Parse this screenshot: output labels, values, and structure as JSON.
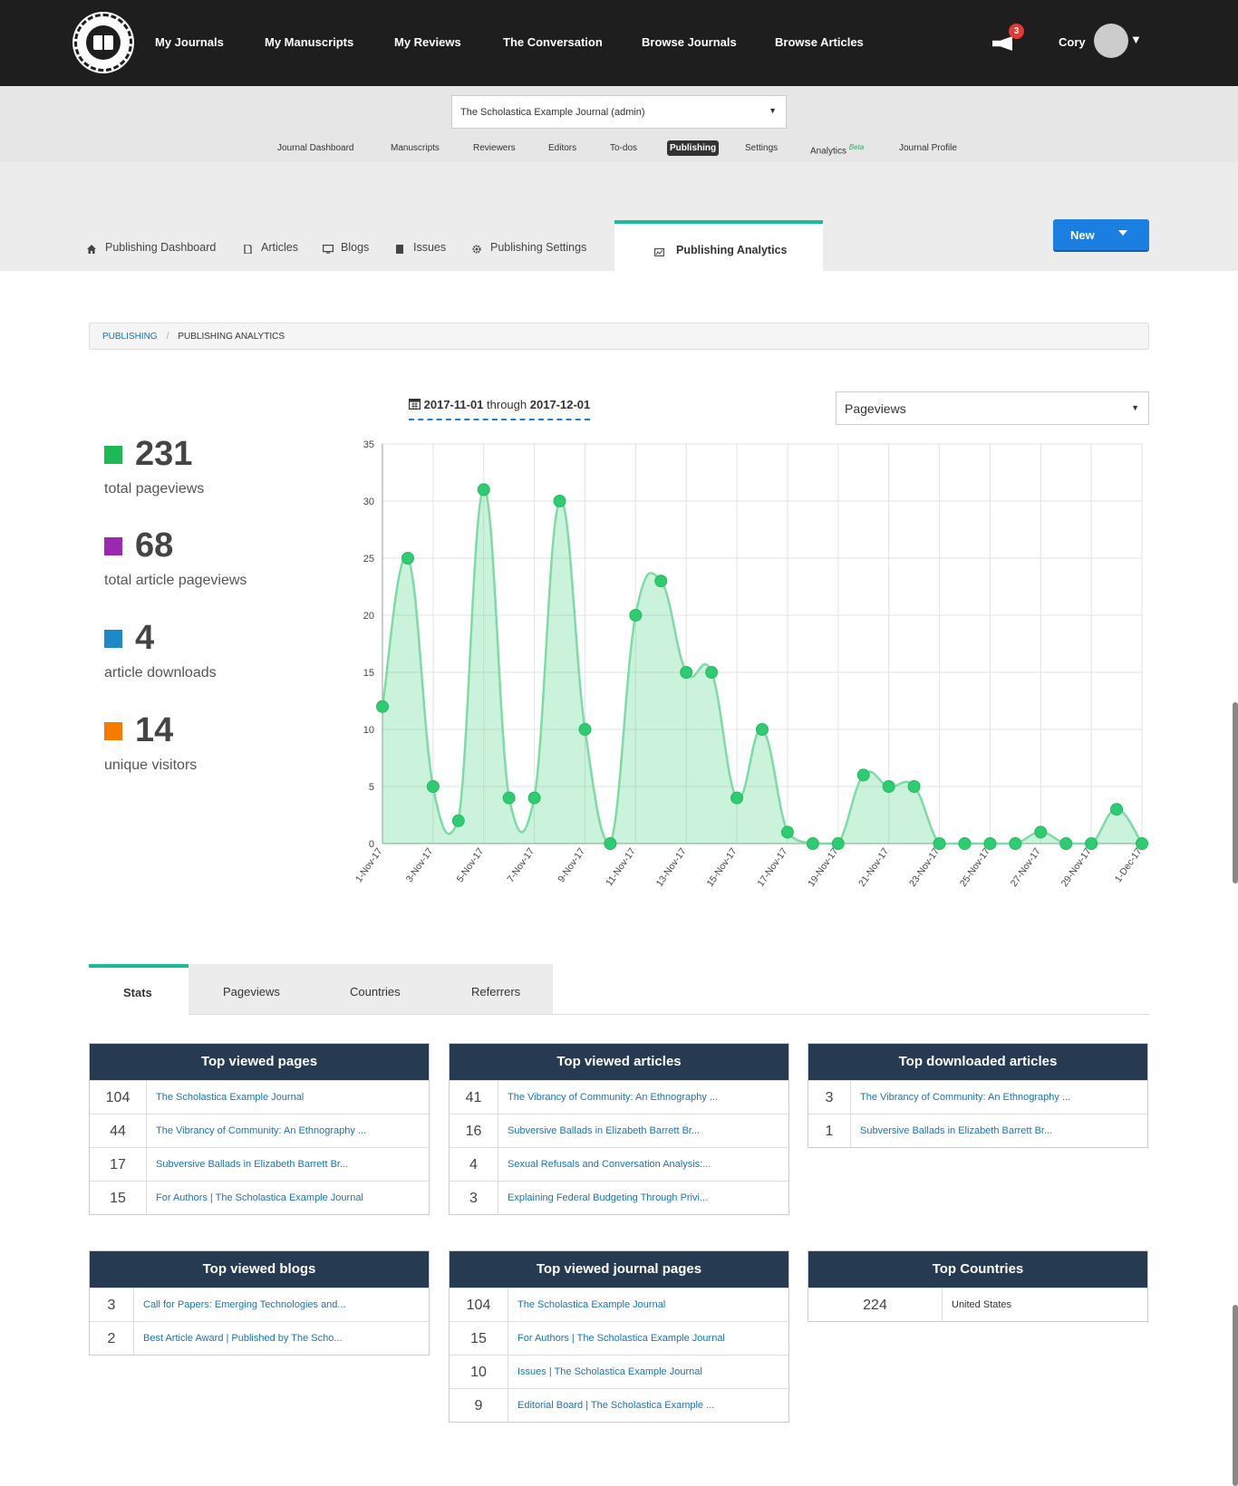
{
  "topnav": {
    "links": [
      "My Journals",
      "My Manuscripts",
      "My Reviews",
      "The Conversation",
      "Browse Journals",
      "Browse Articles"
    ],
    "notification_count": "3",
    "user": "Cory"
  },
  "journal": {
    "selected": "The Scholastica Example Journal (admin)",
    "links": [
      "Journal Dashboard",
      "Manuscripts",
      "Reviewers",
      "Editors",
      "To-dos",
      "Publishing",
      "Settings",
      "Analytics",
      "Journal Profile"
    ],
    "beta": "Beta"
  },
  "subtabs": {
    "items": [
      "Publishing Dashboard",
      "Articles",
      "Blogs",
      "Issues",
      "Publishing Settings"
    ],
    "active": "Publishing Analytics",
    "new_button": "New"
  },
  "breadcrumb": {
    "parent": "PUBLISHING",
    "sep": "/",
    "current": "PUBLISHING ANALYTICS"
  },
  "stats": [
    {
      "value": "231",
      "label": "total pageviews",
      "color": "#1db954"
    },
    {
      "value": "68",
      "label": "total article pageviews",
      "color": "#9c27b0"
    },
    {
      "value": "4",
      "label": "article downloads",
      "color": "#1e88c8"
    },
    {
      "value": "14",
      "label": "unique visitors",
      "color": "#f57c00"
    }
  ],
  "daterange": {
    "start": "2017-11-01",
    "through": "through",
    "end": "2017-12-01"
  },
  "metric": "Pageviews",
  "chart_data": {
    "type": "area",
    "x": [
      "1-Nov-17",
      "2-Nov-17",
      "3-Nov-17",
      "4-Nov-17",
      "5-Nov-17",
      "6-Nov-17",
      "7-Nov-17",
      "8-Nov-17",
      "9-Nov-17",
      "10-Nov-17",
      "11-Nov-17",
      "12-Nov-17",
      "13-Nov-17",
      "14-Nov-17",
      "15-Nov-17",
      "16-Nov-17",
      "17-Nov-17",
      "18-Nov-17",
      "19-Nov-17",
      "20-Nov-17",
      "21-Nov-17",
      "22-Nov-17",
      "23-Nov-17",
      "24-Nov-17",
      "25-Nov-17",
      "26-Nov-17",
      "27-Nov-17",
      "28-Nov-17",
      "29-Nov-17",
      "30-Nov-17",
      "1-Dec-17"
    ],
    "tick_labels": [
      "1-Nov-17",
      "3-Nov-17",
      "5-Nov-17",
      "7-Nov-17",
      "9-Nov-17",
      "11-Nov-17",
      "13-Nov-17",
      "15-Nov-17",
      "17-Nov-17",
      "19-Nov-17",
      "21-Nov-17",
      "23-Nov-17",
      "25-Nov-17",
      "27-Nov-17",
      "29-Nov-17",
      "1-Dec-17"
    ],
    "values": [
      12,
      25,
      5,
      2,
      31,
      4,
      4,
      30,
      10,
      0,
      20,
      23,
      15,
      15,
      4,
      10,
      1,
      0,
      0,
      6,
      5,
      5,
      0,
      0,
      0,
      0,
      1,
      0,
      0,
      3,
      0
    ],
    "ylim": [
      0,
      35
    ],
    "yticks": [
      0,
      5,
      10,
      15,
      20,
      25,
      30,
      35
    ],
    "grid": true,
    "color": "#2ecc71"
  },
  "bottom_tabs": [
    "Stats",
    "Pageviews",
    "Countries",
    "Referrers"
  ],
  "tables": {
    "top_pages": {
      "title": "Top viewed pages",
      "rows": [
        [
          "104",
          "The Scholastica Example Journal"
        ],
        [
          "44",
          "The Vibrancy of Community: An Ethnography ..."
        ],
        [
          "17",
          "Subversive Ballads in Elizabeth Barrett Br..."
        ],
        [
          "15",
          "For Authors | The Scholastica Example Journal"
        ]
      ]
    },
    "top_articles": {
      "title": "Top viewed articles",
      "rows": [
        [
          "41",
          "The Vibrancy of Community: An Ethnography ..."
        ],
        [
          "16",
          "Subversive Ballads in Elizabeth Barrett Br..."
        ],
        [
          "4",
          "Sexual Refusals and Conversation Analysis:..."
        ],
        [
          "3",
          "Explaining Federal Budgeting Through Privi..."
        ]
      ]
    },
    "top_downloads": {
      "title": "Top downloaded articles",
      "rows": [
        [
          "3",
          "The Vibrancy of Community: An Ethnography ..."
        ],
        [
          "1",
          "Subversive Ballads in Elizabeth Barrett Br..."
        ]
      ]
    },
    "top_blogs": {
      "title": "Top viewed blogs",
      "rows": [
        [
          "3",
          "Call for Papers: Emerging Technologies and..."
        ],
        [
          "2",
          "Best Article Award | Published by The Scho..."
        ]
      ]
    },
    "top_journal_pages": {
      "title": "Top viewed journal pages",
      "rows": [
        [
          "104",
          "The Scholastica Example Journal"
        ],
        [
          "15",
          "For Authors | The Scholastica Example Journal"
        ],
        [
          "10",
          "Issues | The Scholastica Example Journal"
        ],
        [
          "9",
          "Editorial Board | The Scholastica Example ..."
        ]
      ]
    },
    "top_countries": {
      "title": "Top Countries",
      "rows": [
        [
          "224",
          "United States"
        ]
      ]
    }
  }
}
